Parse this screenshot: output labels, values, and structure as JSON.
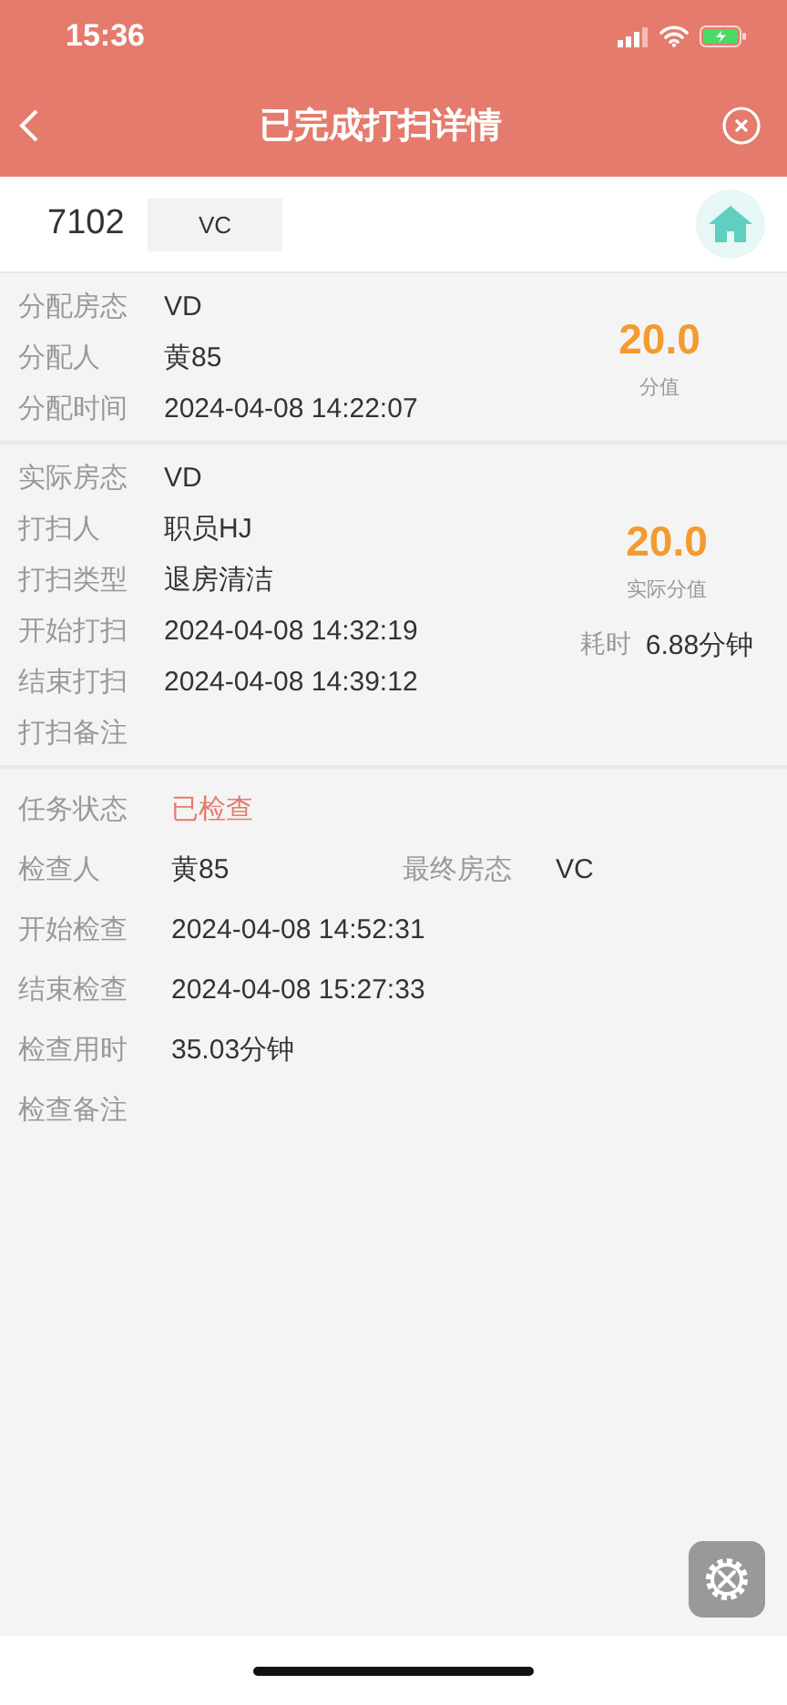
{
  "status_bar": {
    "time": "15:36"
  },
  "header": {
    "title": "已完成打扫详情"
  },
  "room": {
    "number": "7102",
    "status": "VC"
  },
  "assignment": {
    "fields": [
      {
        "label": "分配房态",
        "value": "VD"
      },
      {
        "label": "分配人",
        "value": "黄85"
      },
      {
        "label": "分配时间",
        "value": "2024-04-08 14:22:07"
      }
    ],
    "score": {
      "value": "20.0",
      "label": "分值"
    }
  },
  "cleaning": {
    "fields": [
      {
        "label": "实际房态",
        "value": "VD"
      },
      {
        "label": "打扫人",
        "value": "职员HJ"
      },
      {
        "label": "打扫类型",
        "value": "退房清洁"
      },
      {
        "label": "开始打扫",
        "value": "2024-04-08 14:32:19"
      },
      {
        "label": "结束打扫",
        "value": "2024-04-08 14:39:12"
      },
      {
        "label": "打扫备注"
      }
    ],
    "score": {
      "value": "20.0",
      "label": "实际分值"
    },
    "duration": {
      "label": "耗时",
      "value": "6.88分钟"
    }
  },
  "inspection": {
    "fields": [
      {
        "kind": "status",
        "label": "任务状态",
        "value": "已检查"
      },
      {
        "kind": "pair",
        "label": "检查人",
        "value": "黄85",
        "extra_label": "最终房态",
        "extra_value": "VC"
      },
      {
        "kind": "plain",
        "label": "开始检查",
        "value": "2024-04-08 14:52:31"
      },
      {
        "kind": "plain",
        "label": "结束检查",
        "value": "2024-04-08 15:27:33"
      },
      {
        "kind": "plain",
        "label": "检查用时",
        "value": "35.03分钟"
      },
      {
        "kind": "plain",
        "label": "检查备注"
      }
    ]
  }
}
